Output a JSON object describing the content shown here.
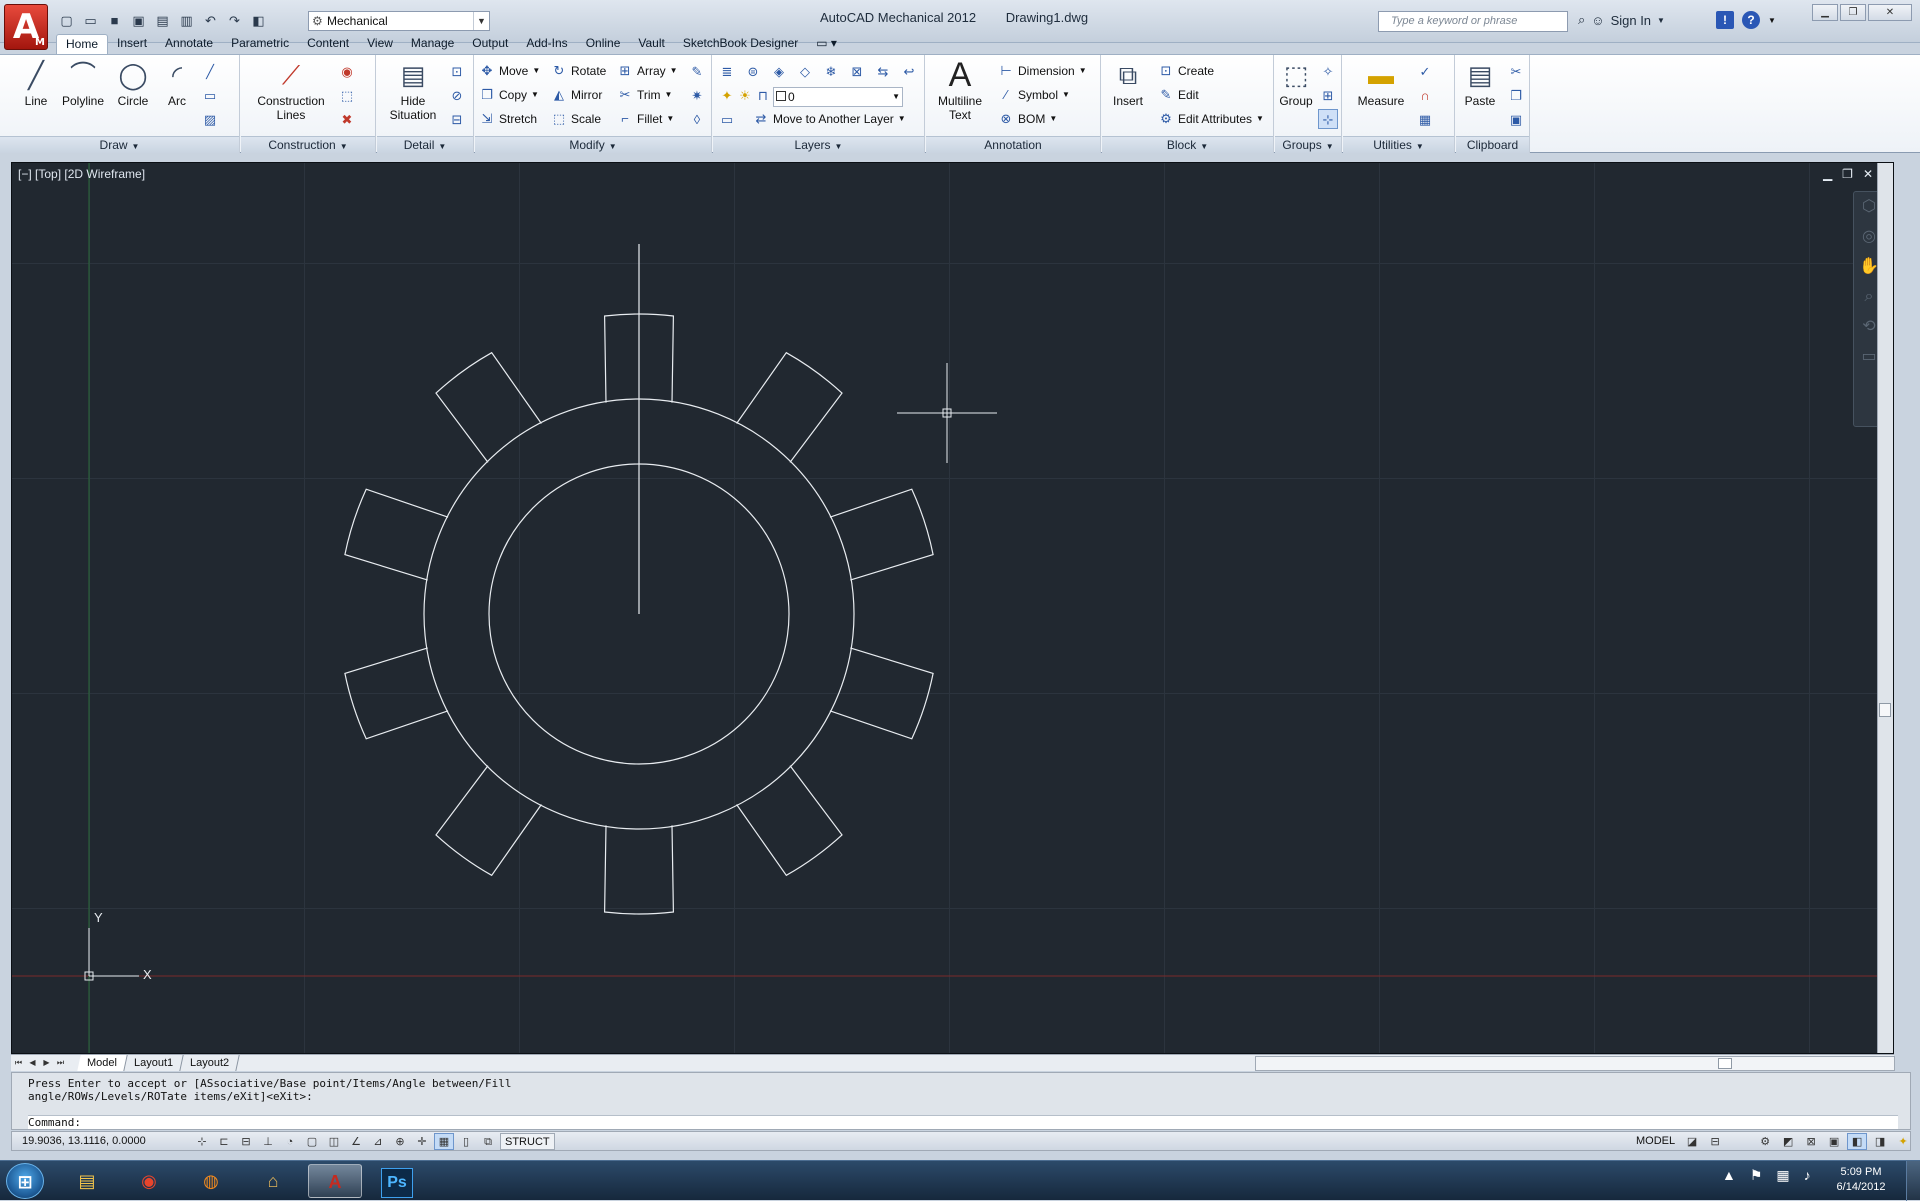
{
  "app": {
    "logo_letter": "A",
    "logo_sub": "M",
    "title": "AutoCAD Mechanical 2012",
    "document": "Drawing1.dwg",
    "workspace": "Mechanical",
    "search_placeholder": "Type a keyword or phrase",
    "sign_in": "Sign In"
  },
  "ribbon_tabs": [
    {
      "label": "Home"
    },
    {
      "label": "Insert"
    },
    {
      "label": "Annotate"
    },
    {
      "label": "Parametric"
    },
    {
      "label": "Content"
    },
    {
      "label": "View"
    },
    {
      "label": "Manage"
    },
    {
      "label": "Output"
    },
    {
      "label": "Add-Ins"
    },
    {
      "label": "Online"
    },
    {
      "label": "Vault"
    },
    {
      "label": "SketchBook Designer"
    }
  ],
  "panels": {
    "draw": {
      "title": "Draw",
      "line": "Line",
      "polyline": "Polyline",
      "circle": "Circle",
      "arc": "Arc"
    },
    "construction": {
      "title": "Construction",
      "lines": "Construction\nLines"
    },
    "detail": {
      "title": "Detail",
      "hide": "Hide\nSituation"
    },
    "modify": {
      "title": "Modify",
      "move": "Move",
      "rotate": "Rotate",
      "array": "Array",
      "copy": "Copy",
      "mirror": "Mirror",
      "trim": "Trim",
      "stretch": "Stretch",
      "scale": "Scale",
      "fillet": "Fillet"
    },
    "layers": {
      "title": "Layers",
      "current_layer": "0",
      "move_to_layer": "Move to Another Layer"
    },
    "annotation": {
      "title": "Annotation",
      "mtext": "Multiline\nText",
      "dimension": "Dimension",
      "symbol": "Symbol",
      "bom": "BOM"
    },
    "block": {
      "title": "Block",
      "insert": "Insert",
      "create": "Create",
      "edit": "Edit",
      "edit_attributes": "Edit Attributes"
    },
    "groups": {
      "title": "Groups",
      "group": "Group"
    },
    "utilities": {
      "title": "Utilities",
      "measure": "Measure"
    },
    "clipboard": {
      "title": "Clipboard",
      "paste": "Paste"
    }
  },
  "viewport": {
    "label": "[−] [Top] [2D Wireframe]",
    "ucs_y": "Y",
    "ucs_x": "X"
  },
  "layout_tabs": [
    {
      "label": "Model"
    },
    {
      "label": "Layout1"
    },
    {
      "label": "Layout2"
    }
  ],
  "command": {
    "history_line1": "Press Enter to accept or [ASsociative/Base point/Items/Angle between/Fill",
    "history_line2": "angle/ROWs/Levels/ROTate items/eXit]<eXit>:",
    "prompt": "Command:"
  },
  "status": {
    "coordinates": "19.9036, 13.1116, 0.0000",
    "struct": "STRUCT",
    "model": "MODEL"
  },
  "taskbar": {
    "time": "5:09 PM",
    "date": "6/14/2012",
    "photoshop": "Ps"
  },
  "colors": {
    "viewport_bg": "#212830",
    "drawing_line": "#e8ecf0",
    "autocad_red": "#c62a1f"
  }
}
